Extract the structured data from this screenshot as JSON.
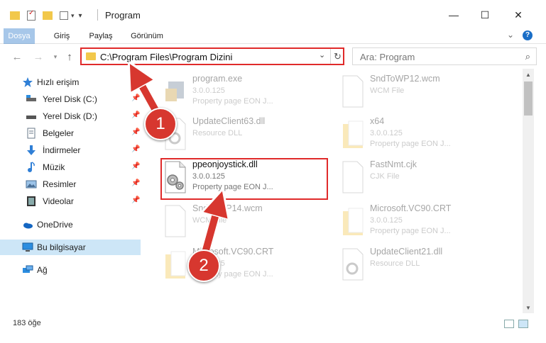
{
  "window": {
    "title": "Program",
    "minimize_glyph": "—",
    "maximize_glyph": "☐",
    "close_glyph": "✕"
  },
  "ribbon": {
    "tabs": [
      "Dosya",
      "Giriş",
      "Paylaş",
      "Görünüm"
    ],
    "expand_glyph": "⌄",
    "help_glyph": "?"
  },
  "address": {
    "path": "C:\\Program Files\\Program Dizini",
    "search_placeholder": "Ara: Program"
  },
  "sidebar": {
    "items": [
      {
        "label": "Hızlı erişim",
        "icon": "star-icon"
      },
      {
        "label": "Yerel Disk (C:)",
        "icon": "disk-c-icon",
        "pinned": true
      },
      {
        "label": "Yerel Disk (D:)",
        "icon": "disk-d-icon",
        "pinned": true
      },
      {
        "label": "Belgeler",
        "icon": "documents-icon",
        "pinned": true
      },
      {
        "label": "İndirmeler",
        "icon": "download-icon",
        "pinned": true
      },
      {
        "label": "Müzik",
        "icon": "music-icon",
        "pinned": true
      },
      {
        "label": "Resimler",
        "icon": "pictures-icon",
        "pinned": true
      },
      {
        "label": "Videolar",
        "icon": "videos-icon",
        "pinned": true
      },
      {
        "label": "OneDrive",
        "icon": "onedrive-icon"
      },
      {
        "label": "Bu bilgisayar",
        "icon": "this-pc-icon",
        "selected": true
      },
      {
        "label": "Ağ",
        "icon": "network-icon"
      }
    ],
    "pin_glyph": "📌"
  },
  "files": [
    {
      "name": "program.exe",
      "line2": "3.0.0.125",
      "line3": "Property page EON J...",
      "icon": "exe-icon"
    },
    {
      "name": "SndToWP12.wcm",
      "line2": "WCM File",
      "line3": "",
      "icon": "blank-file-icon"
    },
    {
      "name": "UpdateClient63.dll",
      "line2": "Resource DLL",
      "line3": "",
      "icon": "dll-icon"
    },
    {
      "name": "x64",
      "line2": "3.0.0.125",
      "line3": "Property page EON J...",
      "icon": "folder-icon"
    },
    {
      "name": "ppeonjoystick.dll",
      "line2": "3.0.0.125",
      "line3": "Property page EON J...",
      "icon": "dll-gear-icon",
      "highlighted": true
    },
    {
      "name": "FastNmt.cjk",
      "line2": "CJK File",
      "line3": "",
      "icon": "blank-file-icon"
    },
    {
      "name": "SndToWP14.wcm",
      "line2": "WCM File",
      "line3": "",
      "icon": "blank-file-icon"
    },
    {
      "name": "Microsoft.VC90.CRT",
      "line2": "3.0.0.125",
      "line3": "Property page EON J...",
      "icon": "folder-icon"
    },
    {
      "name": "Microsoft.VC90.CRT",
      "line2": "3.0.0.125",
      "line3": "Property page EON J...",
      "icon": "folder-icon"
    },
    {
      "name": "UpdateClient21.dll",
      "line2": "Resource DLL",
      "line3": "",
      "icon": "dll-icon"
    }
  ],
  "status": {
    "count_text": "183 öğe"
  },
  "annotations": {
    "step1": "1",
    "step2": "2",
    "color": "#d7372f"
  }
}
